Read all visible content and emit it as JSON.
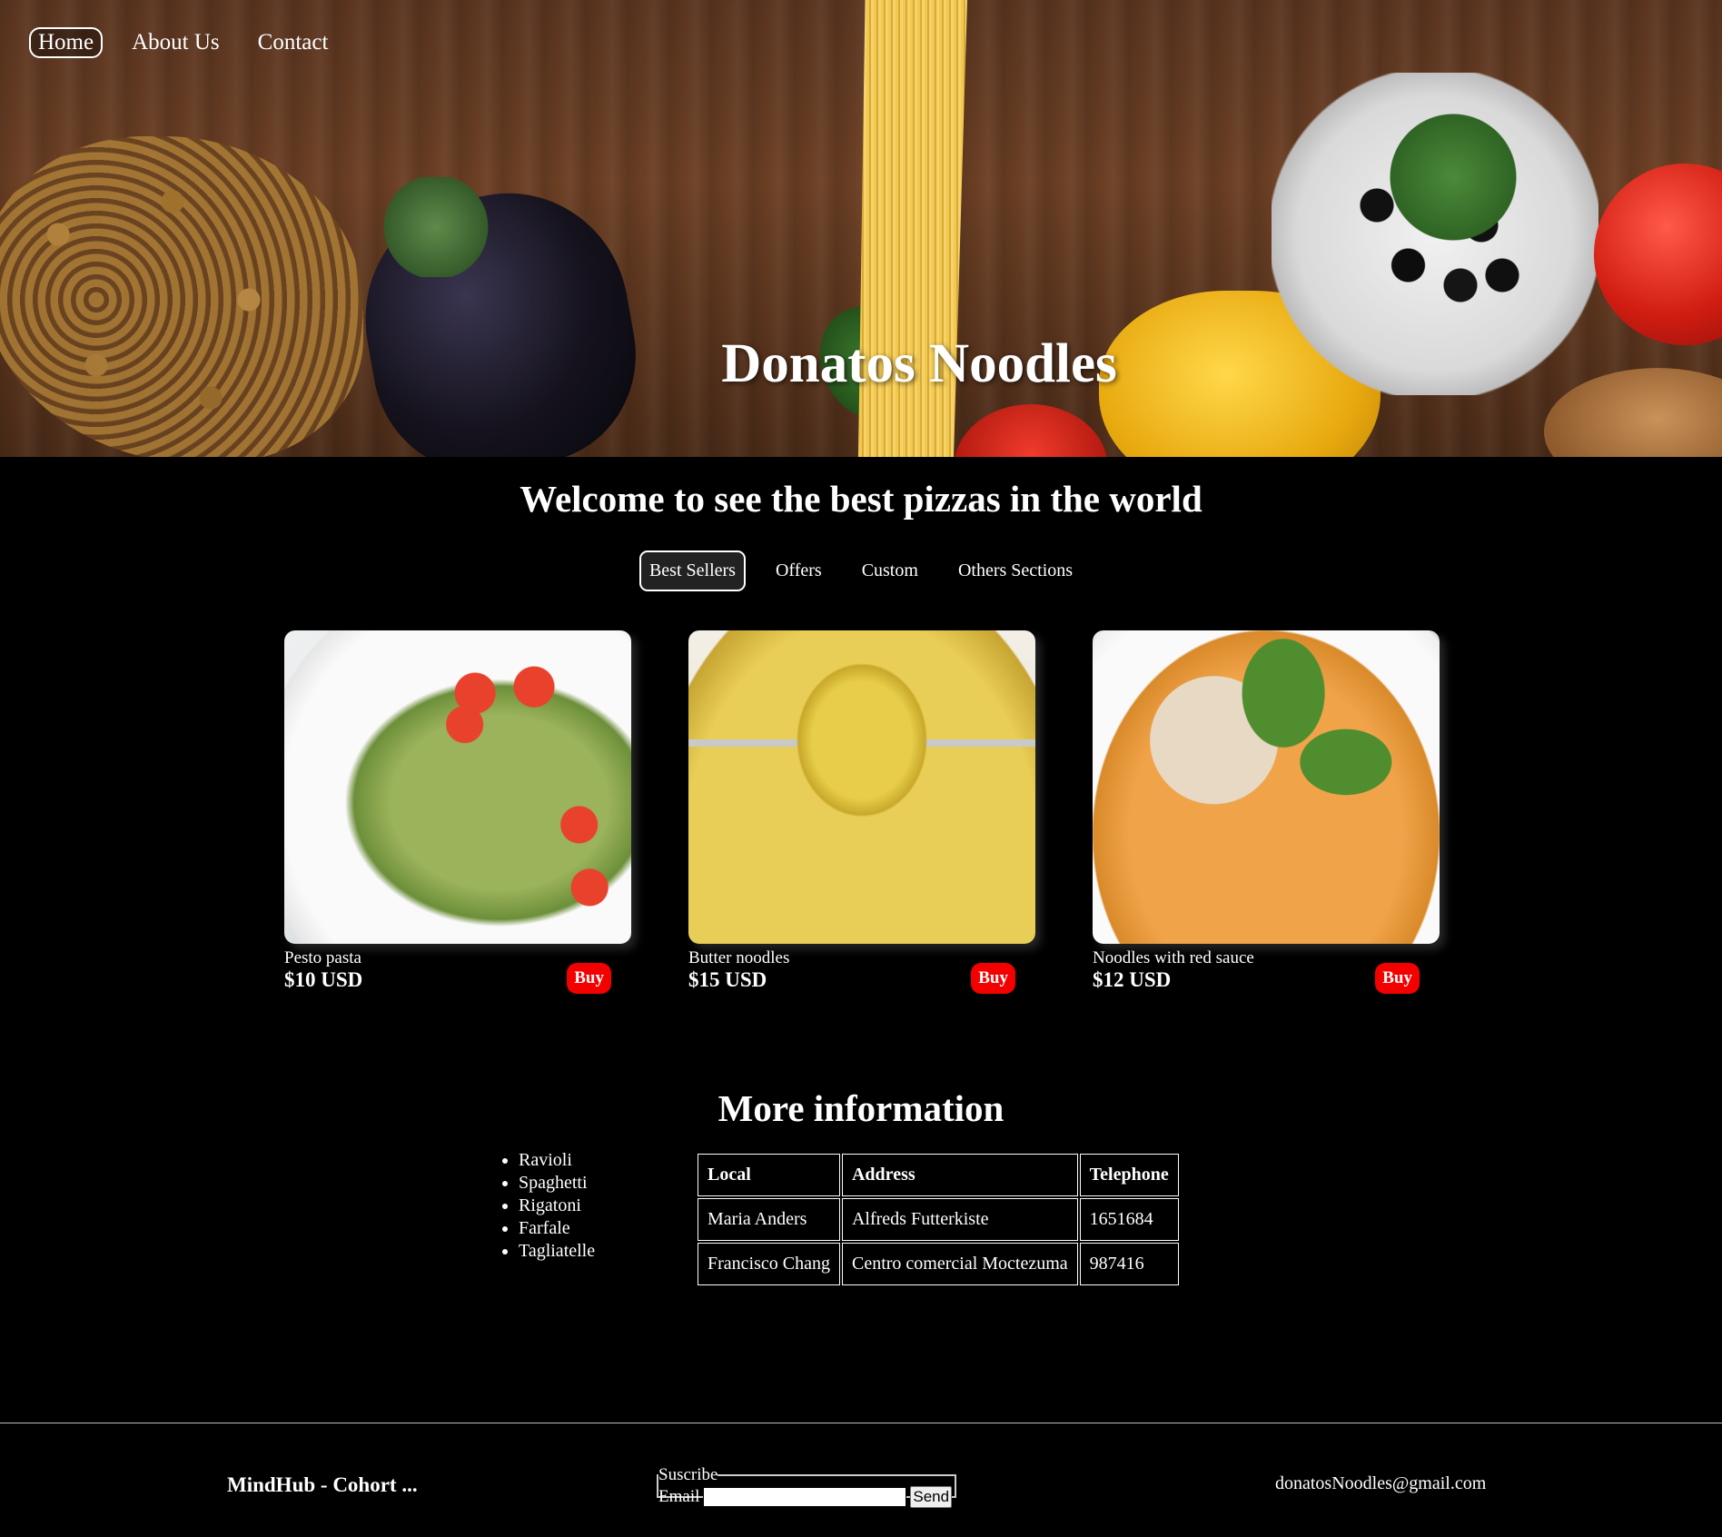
{
  "nav": {
    "items": [
      {
        "label": "Home",
        "active": true
      },
      {
        "label": "About Us",
        "active": false
      },
      {
        "label": "Contact",
        "active": false
      }
    ]
  },
  "hero": {
    "title": "Donatos Noodles"
  },
  "welcome": {
    "heading": "Welcome to see the best pizzas in the world"
  },
  "tabs": [
    {
      "label": "Best Sellers",
      "active": true
    },
    {
      "label": "Offers",
      "active": false
    },
    {
      "label": "Custom",
      "active": false
    },
    {
      "label": "Others Sections",
      "active": false
    }
  ],
  "products": [
    {
      "name": "Pesto pasta",
      "price": "$10 USD",
      "buy_label": "Buy"
    },
    {
      "name": "Butter noodles",
      "price": "$15 USD",
      "buy_label": "Buy"
    },
    {
      "name": "Noodles with red sauce",
      "price": "$12 USD",
      "buy_label": "Buy"
    }
  ],
  "more_info": {
    "heading": "More information",
    "pasta_types": [
      "Ravioli",
      "Spaghetti",
      "Rigatoni",
      "Farfale",
      "Tagliatelle"
    ],
    "table": {
      "headers": [
        "Local",
        "Address",
        "Telephone"
      ],
      "rows": [
        [
          "Maria Anders",
          "Alfreds Futterkiste",
          "1651684"
        ],
        [
          "Francisco Chang",
          "Centro comercial Moctezuma",
          "987416"
        ]
      ]
    }
  },
  "footer": {
    "left_text": "MindHub - Cohort ...",
    "subscribe": {
      "legend": "Suscribe",
      "email_label": "Email",
      "email_value": "",
      "send_label": "Send"
    },
    "email": "donatosNoodles@gmail.com"
  },
  "colors": {
    "background": "#000000",
    "buy_button": "#f40000",
    "text": "#ffffff"
  }
}
